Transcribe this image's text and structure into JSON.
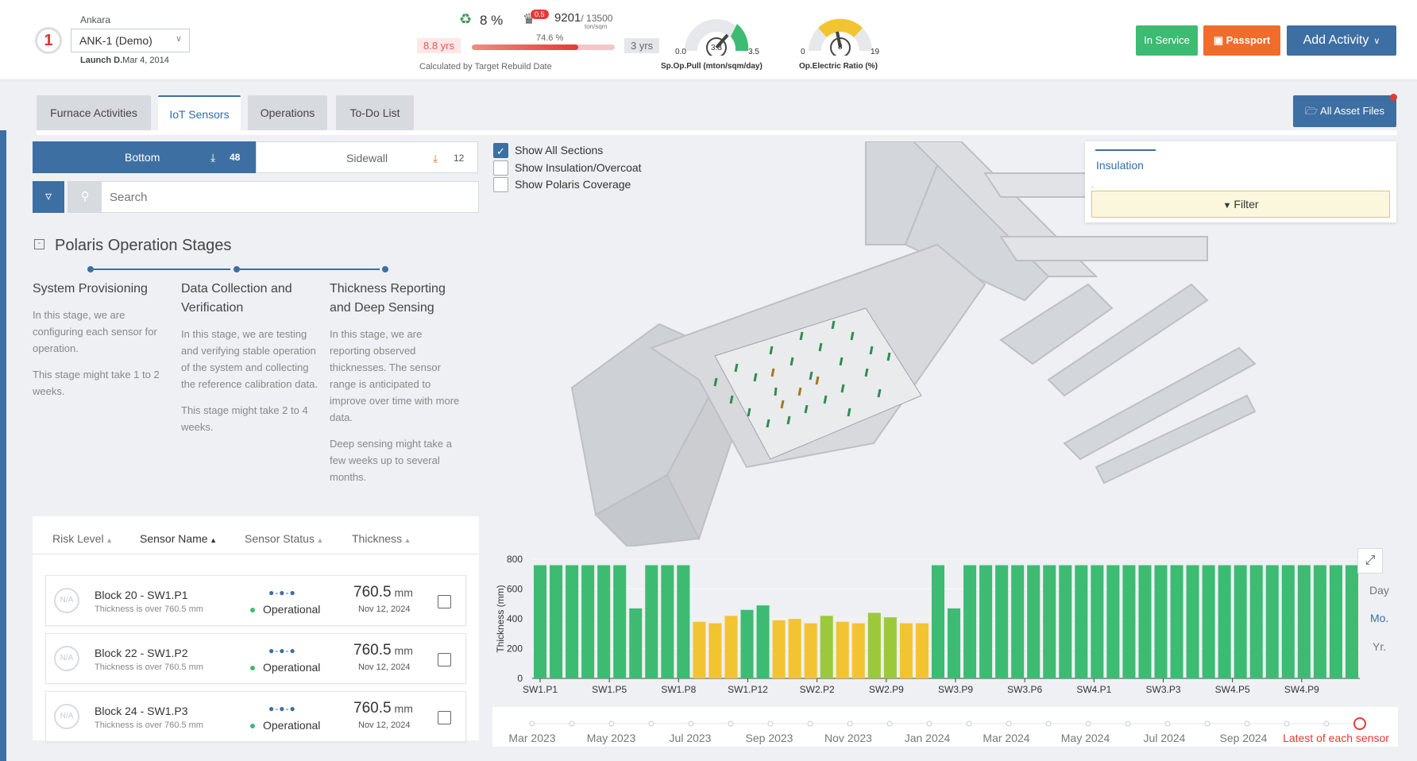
{
  "header": {
    "logo_text": "1",
    "city": "Ankara",
    "asset": "ANK-1 (Demo)",
    "launch_label": "Launch D.",
    "launch_date": "Mar 4, 2014",
    "recycle_pct": "8 %",
    "bell_badge": "0.5",
    "tons_current": "9201",
    "tons_total": "/ 13500",
    "tons_unit": "ton/sqm",
    "campaign_pct": "74.6 %",
    "campaign_progress": 0.746,
    "years_left": "8.8 yrs",
    "years_right": "3 yrs",
    "calc_note": "Calculated by Target Rebuild Date",
    "gauge_pull": {
      "min": "0.0",
      "value": "3.3",
      "max": "3.5",
      "title": "Sp.Op.Pull (mton/sqm/day)",
      "color": "#3dbb72"
    },
    "gauge_elec": {
      "min": "0",
      "value": "8",
      "max": "19",
      "title": "Op.Electric Ratio (%)",
      "color": "#f3c431"
    },
    "buttons": {
      "service": "In Service",
      "passport": "Passport",
      "add": "Add Activity"
    }
  },
  "tabs": [
    "Furnace Activities",
    "IoT Sensors",
    "Operations",
    "To-Do List"
  ],
  "active_tab": 1,
  "all_files": "All Asset Files",
  "segments": {
    "bottom_label": "Bottom",
    "bottom_count": "48",
    "side_label": "Sidewall",
    "side_count": "12"
  },
  "search": {
    "placeholder": "Search"
  },
  "stages": {
    "title": "Polaris Operation Stages",
    "items": [
      {
        "title": "System Provisioning",
        "p1": "In this stage, we are configuring each sensor for operation.",
        "p2": "This stage might take 1 to 2 weeks.",
        "p3": ""
      },
      {
        "title": "Data Collection and Verification",
        "p1": "In this stage, we are testing and verifying stable operation of the system and collecting the reference calibration data.",
        "p2": "This stage might take 2 to 4 weeks.",
        "p3": ""
      },
      {
        "title": "Thickness Reporting and Deep Sensing",
        "p1": "In this stage, we are reporting observed thicknesses. The sensor range is anticipated to improve over time with more data.",
        "p2": "Deep sensing might take a few weeks up to several months.",
        "p3": ""
      }
    ]
  },
  "table": {
    "headers": [
      "Risk Level",
      "Sensor Name",
      "Sensor Status",
      "Thickness"
    ],
    "rows": [
      {
        "name": "Block 20 - SW1.P1",
        "sub": "Thickness is over 760.5 mm",
        "status": "Operational",
        "value": "760.5",
        "unit": "mm",
        "date": "Nov 12, 2024",
        "na": "N/A"
      },
      {
        "name": "Block 22 - SW1.P2",
        "sub": "Thickness is over 760.5 mm",
        "status": "Operational",
        "value": "760.5",
        "unit": "mm",
        "date": "Nov 12, 2024",
        "na": "N/A"
      },
      {
        "name": "Block 24 - SW1.P3",
        "sub": "Thickness is over 760.5 mm",
        "status": "Operational",
        "value": "760.5",
        "unit": "mm",
        "date": "Nov 12, 2024",
        "na": "N/A"
      }
    ]
  },
  "options": [
    {
      "label": "Show All Sections",
      "checked": true
    },
    {
      "label": "Show Insulation/Overcoat",
      "checked": false
    },
    {
      "label": "Show Polaris Coverage",
      "checked": false
    }
  ],
  "insulation": {
    "tab": "Insulation",
    "dash": "-",
    "filter": "Filter"
  },
  "side_controls": [
    "Day",
    "Mo.",
    "Yr."
  ],
  "active_control": 1,
  "timeline": {
    "labels": [
      "Mar 2023",
      "May 2023",
      "Jul 2023",
      "Sep 2023",
      "Nov 2023",
      "Jan 2024",
      "Mar 2024",
      "May 2024",
      "Jul 2024",
      "Sep 2024"
    ],
    "latest": "Latest of each sensor"
  },
  "colors": {
    "green": "#3dbb72",
    "yellow": "#f3c431",
    "lime": "#9cc93a",
    "accent": "#3d6fa3"
  },
  "chart_data": {
    "type": "bar",
    "ylabel": "Thickness (mm)",
    "ylim": [
      0,
      800
    ],
    "yticks": [
      0,
      200,
      400,
      600,
      800
    ],
    "xticks": [
      "SW1.P1",
      "SW1.P5",
      "SW1.P8",
      "SW1.P12",
      "SW2.P2",
      "SW2.P9",
      "SW3.P9",
      "SW3.P6",
      "SW4.P1",
      "SW3.P3",
      "SW4.P5",
      "SW4.P9"
    ],
    "values": [
      760,
      760,
      760,
      760,
      760,
      760,
      470,
      760,
      760,
      760,
      380,
      370,
      420,
      460,
      490,
      390,
      400,
      370,
      420,
      380,
      370,
      440,
      410,
      370,
      370,
      760,
      470,
      760,
      760,
      760,
      760,
      760,
      760,
      760,
      760,
      760,
      760,
      760,
      760,
      760,
      760,
      760,
      760,
      760,
      760,
      760,
      760,
      760,
      760,
      760,
      760,
      760
    ],
    "colors": [
      "g",
      "g",
      "g",
      "g",
      "g",
      "g",
      "g",
      "g",
      "g",
      "g",
      "y",
      "y",
      "y",
      "g",
      "g",
      "y",
      "y",
      "y",
      "l",
      "y",
      "y",
      "l",
      "l",
      "y",
      "y",
      "g",
      "g",
      "g",
      "g",
      "g",
      "g",
      "g",
      "g",
      "g",
      "g",
      "g",
      "g",
      "g",
      "g",
      "g",
      "g",
      "g",
      "g",
      "g",
      "g",
      "g",
      "g",
      "g",
      "g",
      "g",
      "g",
      "g"
    ]
  }
}
